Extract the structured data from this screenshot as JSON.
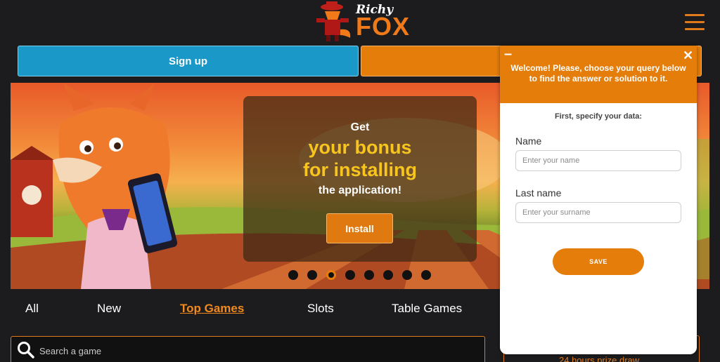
{
  "header": {
    "logo_small": "Richy",
    "logo_big": "FOX",
    "menu_icon": "hamburger-menu-icon"
  },
  "auth": {
    "signup_label": "Sign up",
    "login_label": ""
  },
  "banner": {
    "get": "Get",
    "line1": "your bonus",
    "line2": "for installing",
    "line3": "the application!",
    "install_label": "Install",
    "slide_count": 8,
    "active_slide": 3
  },
  "tabs": [
    {
      "label": "All",
      "active": false
    },
    {
      "label": "New",
      "active": false
    },
    {
      "label": "Top Games",
      "active": true
    },
    {
      "label": "Slots",
      "active": false
    },
    {
      "label": "Table Games",
      "active": false
    }
  ],
  "search": {
    "placeholder": "Search a game",
    "icon": "search-icon"
  },
  "side_panel": {
    "label": "24 hours prize draw"
  },
  "popup": {
    "welcome": "Welcome! Please, choose your query below to find the answer or solution to it.",
    "subtitle": "First, specify your data:",
    "name_label": "Name",
    "name_placeholder": "Enter your name",
    "lastname_label": "Last name",
    "lastname_placeholder": "Enter your surname",
    "save_label": "SAVE",
    "minimize_symbol": "–",
    "close_symbol": "✕"
  },
  "colors": {
    "background": "#1c1c1e",
    "signup": "#1a98c8",
    "accent_orange": "#e57d0a",
    "promo_yellow": "#f7c51e"
  }
}
